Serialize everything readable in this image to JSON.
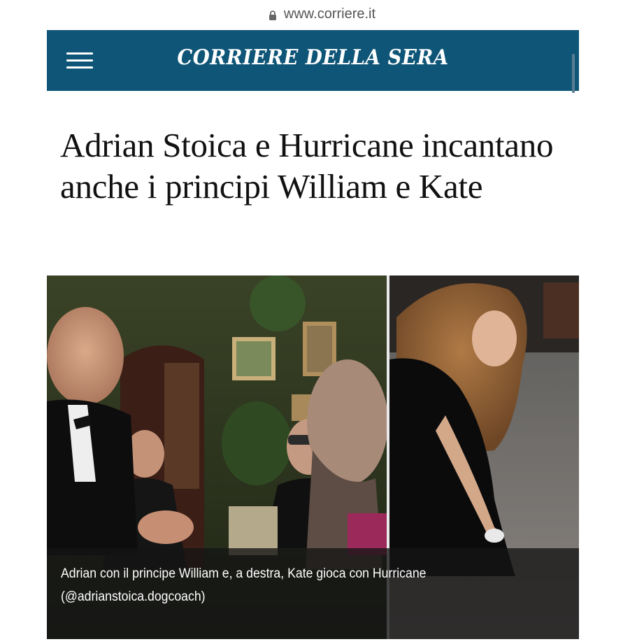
{
  "browser": {
    "url": "www.corriere.it",
    "lock_icon": "lock-icon"
  },
  "masthead": {
    "logo": "CORRIERE DELLA SERA",
    "menu_icon": "hamburger-menu-icon",
    "background_color": "#0e5577"
  },
  "article": {
    "headline": "Adrian Stoica e Hurricane incantano anche i principi William e Kate",
    "caption_line1": "Adrian con il principe William e, a destra,  Kate gioca con Hurricane",
    "caption_line2": "(@adrianstoica.dogcoach)"
  }
}
